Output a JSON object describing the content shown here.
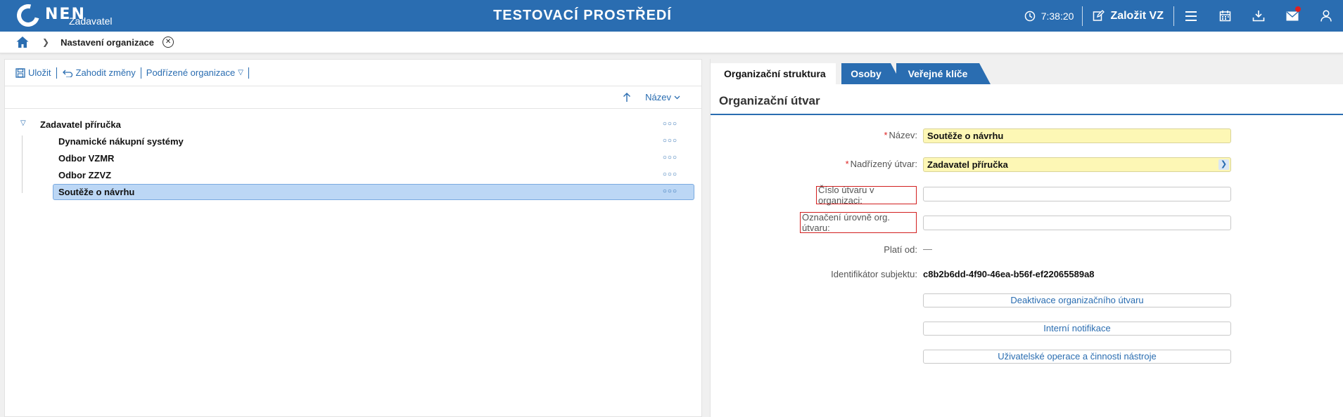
{
  "header": {
    "logo_text": "NEN",
    "logo_sub": "Zadavatel",
    "env_title": "TESTOVACÍ PROSTŘEDÍ",
    "time": "7:38:20",
    "create_label": "Založit VZ"
  },
  "breadcrumb": {
    "page_title": "Nastavení organizace"
  },
  "toolbar": {
    "save": "Uložit",
    "discard": "Zahodit změny",
    "suborgs": "Podřízené organizace"
  },
  "sort": {
    "label": "Název"
  },
  "tree": {
    "root": "Zadavatel příručka",
    "children": [
      "Dynamické nákupní systémy",
      "Odbor VZMR",
      "Odbor ZZVZ",
      "Soutěže o návrhu"
    ]
  },
  "tabs": [
    "Organizační struktura",
    "Osoby",
    "Veřejné klíče"
  ],
  "form": {
    "section_title": "Organizační útvar",
    "name_label": "Název:",
    "name_value": "Soutěže o návrhu",
    "parent_label": "Nadřízený útvar:",
    "parent_value": "Zadavatel příručka",
    "number_label": "Číslo útvaru v organizaci:",
    "number_value": "",
    "level_label": "Označení úrovně org. útvaru:",
    "level_value": "",
    "valid_label": "Platí od:",
    "valid_value": "—",
    "id_label": "Identifikátor subjektu:",
    "id_value": "c8b2b6dd-4f90-46ea-b56f-ef22065589a8",
    "btn_deactivate": "Deaktivace organizačního útvaru",
    "btn_notify": "Interní notifikace",
    "btn_ops": "Uživatelské operace a činnosti nástroje"
  },
  "colors": {
    "primary": "#2a6db1",
    "required_field": "#fdf7b5",
    "selected_row": "#bcd7f5",
    "highlight_border": "#d21f1f"
  }
}
